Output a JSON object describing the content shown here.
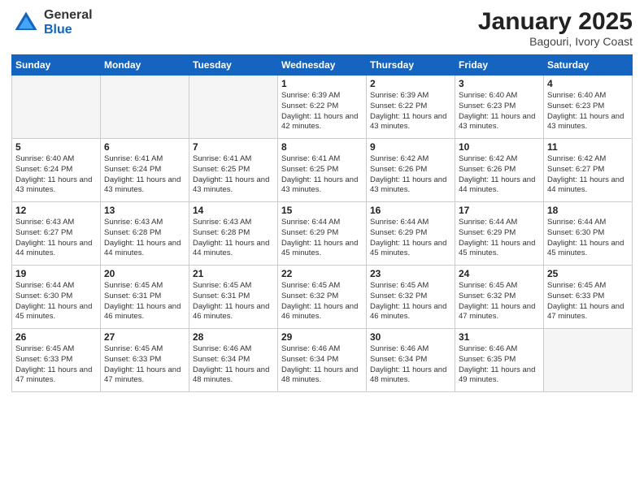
{
  "logo": {
    "general": "General",
    "blue": "Blue"
  },
  "header": {
    "month": "January 2025",
    "location": "Bagouri, Ivory Coast"
  },
  "weekdays": [
    "Sunday",
    "Monday",
    "Tuesday",
    "Wednesday",
    "Thursday",
    "Friday",
    "Saturday"
  ],
  "weeks": [
    [
      {
        "day": "",
        "sunrise": "",
        "sunset": "",
        "daylight": ""
      },
      {
        "day": "",
        "sunrise": "",
        "sunset": "",
        "daylight": ""
      },
      {
        "day": "",
        "sunrise": "",
        "sunset": "",
        "daylight": ""
      },
      {
        "day": "1",
        "sunrise": "Sunrise: 6:39 AM",
        "sunset": "Sunset: 6:22 PM",
        "daylight": "Daylight: 11 hours and 42 minutes."
      },
      {
        "day": "2",
        "sunrise": "Sunrise: 6:39 AM",
        "sunset": "Sunset: 6:22 PM",
        "daylight": "Daylight: 11 hours and 43 minutes."
      },
      {
        "day": "3",
        "sunrise": "Sunrise: 6:40 AM",
        "sunset": "Sunset: 6:23 PM",
        "daylight": "Daylight: 11 hours and 43 minutes."
      },
      {
        "day": "4",
        "sunrise": "Sunrise: 6:40 AM",
        "sunset": "Sunset: 6:23 PM",
        "daylight": "Daylight: 11 hours and 43 minutes."
      }
    ],
    [
      {
        "day": "5",
        "sunrise": "Sunrise: 6:40 AM",
        "sunset": "Sunset: 6:24 PM",
        "daylight": "Daylight: 11 hours and 43 minutes."
      },
      {
        "day": "6",
        "sunrise": "Sunrise: 6:41 AM",
        "sunset": "Sunset: 6:24 PM",
        "daylight": "Daylight: 11 hours and 43 minutes."
      },
      {
        "day": "7",
        "sunrise": "Sunrise: 6:41 AM",
        "sunset": "Sunset: 6:25 PM",
        "daylight": "Daylight: 11 hours and 43 minutes."
      },
      {
        "day": "8",
        "sunrise": "Sunrise: 6:41 AM",
        "sunset": "Sunset: 6:25 PM",
        "daylight": "Daylight: 11 hours and 43 minutes."
      },
      {
        "day": "9",
        "sunrise": "Sunrise: 6:42 AM",
        "sunset": "Sunset: 6:26 PM",
        "daylight": "Daylight: 11 hours and 43 minutes."
      },
      {
        "day": "10",
        "sunrise": "Sunrise: 6:42 AM",
        "sunset": "Sunset: 6:26 PM",
        "daylight": "Daylight: 11 hours and 44 minutes."
      },
      {
        "day": "11",
        "sunrise": "Sunrise: 6:42 AM",
        "sunset": "Sunset: 6:27 PM",
        "daylight": "Daylight: 11 hours and 44 minutes."
      }
    ],
    [
      {
        "day": "12",
        "sunrise": "Sunrise: 6:43 AM",
        "sunset": "Sunset: 6:27 PM",
        "daylight": "Daylight: 11 hours and 44 minutes."
      },
      {
        "day": "13",
        "sunrise": "Sunrise: 6:43 AM",
        "sunset": "Sunset: 6:28 PM",
        "daylight": "Daylight: 11 hours and 44 minutes."
      },
      {
        "day": "14",
        "sunrise": "Sunrise: 6:43 AM",
        "sunset": "Sunset: 6:28 PM",
        "daylight": "Daylight: 11 hours and 44 minutes."
      },
      {
        "day": "15",
        "sunrise": "Sunrise: 6:44 AM",
        "sunset": "Sunset: 6:29 PM",
        "daylight": "Daylight: 11 hours and 45 minutes."
      },
      {
        "day": "16",
        "sunrise": "Sunrise: 6:44 AM",
        "sunset": "Sunset: 6:29 PM",
        "daylight": "Daylight: 11 hours and 45 minutes."
      },
      {
        "day": "17",
        "sunrise": "Sunrise: 6:44 AM",
        "sunset": "Sunset: 6:29 PM",
        "daylight": "Daylight: 11 hours and 45 minutes."
      },
      {
        "day": "18",
        "sunrise": "Sunrise: 6:44 AM",
        "sunset": "Sunset: 6:30 PM",
        "daylight": "Daylight: 11 hours and 45 minutes."
      }
    ],
    [
      {
        "day": "19",
        "sunrise": "Sunrise: 6:44 AM",
        "sunset": "Sunset: 6:30 PM",
        "daylight": "Daylight: 11 hours and 45 minutes."
      },
      {
        "day": "20",
        "sunrise": "Sunrise: 6:45 AM",
        "sunset": "Sunset: 6:31 PM",
        "daylight": "Daylight: 11 hours and 46 minutes."
      },
      {
        "day": "21",
        "sunrise": "Sunrise: 6:45 AM",
        "sunset": "Sunset: 6:31 PM",
        "daylight": "Daylight: 11 hours and 46 minutes."
      },
      {
        "day": "22",
        "sunrise": "Sunrise: 6:45 AM",
        "sunset": "Sunset: 6:32 PM",
        "daylight": "Daylight: 11 hours and 46 minutes."
      },
      {
        "day": "23",
        "sunrise": "Sunrise: 6:45 AM",
        "sunset": "Sunset: 6:32 PM",
        "daylight": "Daylight: 11 hours and 46 minutes."
      },
      {
        "day": "24",
        "sunrise": "Sunrise: 6:45 AM",
        "sunset": "Sunset: 6:32 PM",
        "daylight": "Daylight: 11 hours and 47 minutes."
      },
      {
        "day": "25",
        "sunrise": "Sunrise: 6:45 AM",
        "sunset": "Sunset: 6:33 PM",
        "daylight": "Daylight: 11 hours and 47 minutes."
      }
    ],
    [
      {
        "day": "26",
        "sunrise": "Sunrise: 6:45 AM",
        "sunset": "Sunset: 6:33 PM",
        "daylight": "Daylight: 11 hours and 47 minutes."
      },
      {
        "day": "27",
        "sunrise": "Sunrise: 6:45 AM",
        "sunset": "Sunset: 6:33 PM",
        "daylight": "Daylight: 11 hours and 47 minutes."
      },
      {
        "day": "28",
        "sunrise": "Sunrise: 6:46 AM",
        "sunset": "Sunset: 6:34 PM",
        "daylight": "Daylight: 11 hours and 48 minutes."
      },
      {
        "day": "29",
        "sunrise": "Sunrise: 6:46 AM",
        "sunset": "Sunset: 6:34 PM",
        "daylight": "Daylight: 11 hours and 48 minutes."
      },
      {
        "day": "30",
        "sunrise": "Sunrise: 6:46 AM",
        "sunset": "Sunset: 6:34 PM",
        "daylight": "Daylight: 11 hours and 48 minutes."
      },
      {
        "day": "31",
        "sunrise": "Sunrise: 6:46 AM",
        "sunset": "Sunset: 6:35 PM",
        "daylight": "Daylight: 11 hours and 49 minutes."
      },
      {
        "day": "",
        "sunrise": "",
        "sunset": "",
        "daylight": ""
      }
    ]
  ]
}
